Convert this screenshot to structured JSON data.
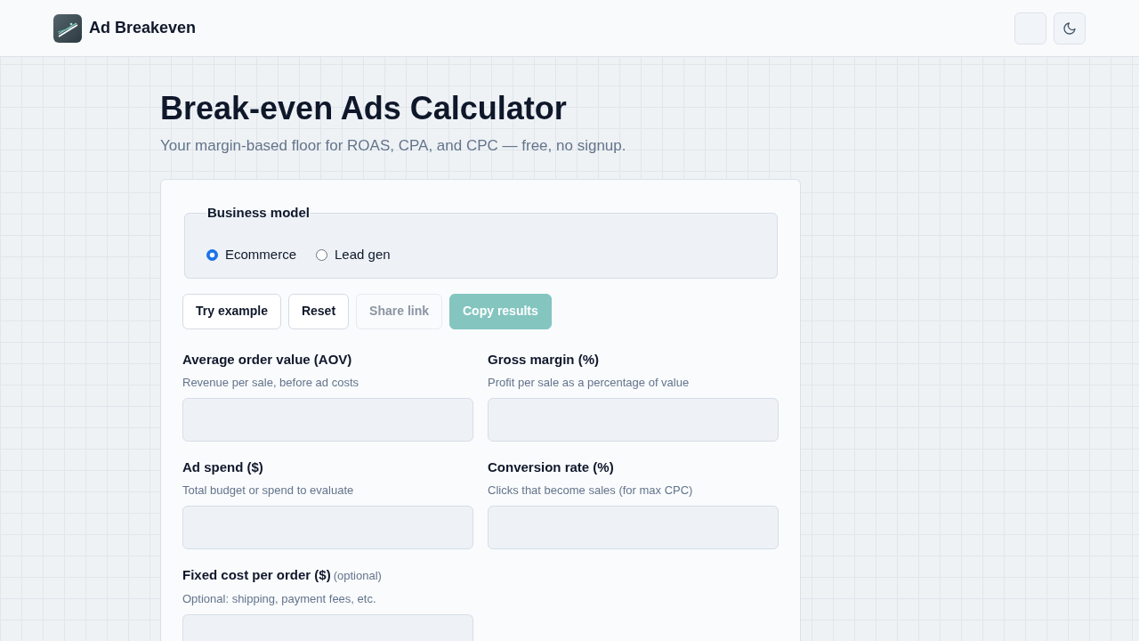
{
  "header": {
    "brand": "Ad Breakeven"
  },
  "page": {
    "title": "Break-even Ads Calculator",
    "subtitle": "Your margin-based floor for ROAS, CPA, and CPC — free, no signup."
  },
  "business_model": {
    "legend": "Business model",
    "options": [
      {
        "label": "Ecommerce",
        "selected": true
      },
      {
        "label": "Lead gen",
        "selected": false
      }
    ]
  },
  "actions": [
    {
      "label": "Try example",
      "kind": "outline",
      "disabled": false
    },
    {
      "label": "Reset",
      "kind": "outline",
      "disabled": false
    },
    {
      "label": "Share link",
      "kind": "outline",
      "disabled": true
    },
    {
      "label": "Copy results",
      "kind": "primary",
      "disabled": true
    }
  ],
  "fields": [
    {
      "label": "Average order value (AOV)",
      "hint": "Revenue per sale, before ad costs"
    },
    {
      "label": "Gross margin (%)",
      "hint": "Profit per sale as a percentage of value"
    },
    {
      "label": "Ad spend ($)",
      "hint": "Total budget or spend to evaluate"
    },
    {
      "label": "Conversion rate (%)",
      "hint": "Clicks that become sales (for max CPC)"
    },
    {
      "label": "Fixed cost per order ($)",
      "tag": "(optional)",
      "hint": "Optional: shipping, payment fees, etc."
    }
  ]
}
